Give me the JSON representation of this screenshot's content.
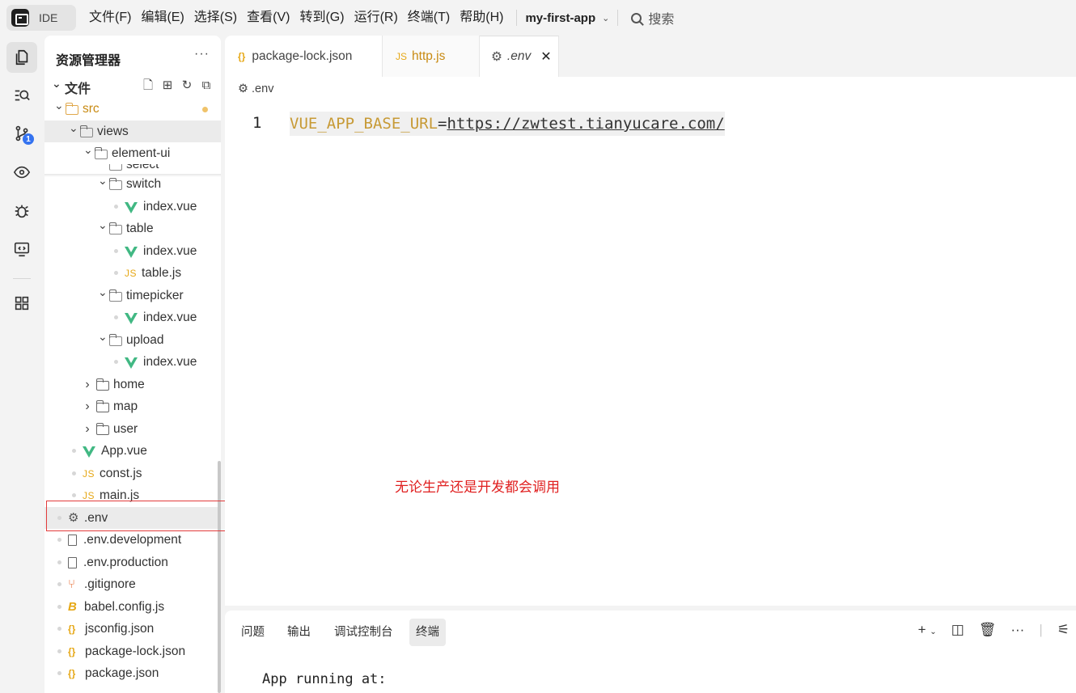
{
  "topbar": {
    "ide_label": "IDE",
    "menu": [
      "文件(F)",
      "编辑(E)",
      "选择(S)",
      "查看(V)",
      "转到(G)",
      "运行(R)",
      "终端(T)",
      "帮助(H)"
    ],
    "project": "my-first-app",
    "search": "搜索"
  },
  "activity": {
    "scm_badge": "1"
  },
  "explorer": {
    "title": "资源管理器",
    "more": "···",
    "section": "文件",
    "rows": [
      {
        "label": "src"
      },
      {
        "label": "views"
      },
      {
        "label": "element-ui"
      },
      {
        "label": "select"
      },
      {
        "label": "switch"
      },
      {
        "label": "index.vue"
      },
      {
        "label": "table"
      },
      {
        "label": "index.vue"
      },
      {
        "label": "table.js"
      },
      {
        "label": "timepicker"
      },
      {
        "label": "index.vue"
      },
      {
        "label": "upload"
      },
      {
        "label": "index.vue"
      },
      {
        "label": "home"
      },
      {
        "label": "map"
      },
      {
        "label": "user"
      },
      {
        "label": "App.vue"
      },
      {
        "label": "const.js"
      },
      {
        "label": "main.js"
      },
      {
        "label": ".env"
      },
      {
        "label": ".env.development"
      },
      {
        "label": ".env.production"
      },
      {
        "label": ".gitignore"
      },
      {
        "label": "babel.config.js"
      },
      {
        "label": "jsconfig.json"
      },
      {
        "label": "package-lock.json"
      },
      {
        "label": "package.json"
      }
    ]
  },
  "editor": {
    "tabs": [
      {
        "icon": "{}",
        "label": "package-lock.json"
      },
      {
        "icon": "JS",
        "label": "http.js"
      },
      {
        "icon": "⚙",
        "label": ".env",
        "close": "✕"
      }
    ],
    "breadcrumb": ".env",
    "line_number": "1",
    "code_key": "VUE_APP_BASE_URL",
    "code_eq": "=",
    "code_value": "https://zwtest.tianyucare.com/",
    "annotation": "无论生产还是开发都会调用"
  },
  "panel": {
    "tabs": [
      "问题",
      "输出",
      "调试控制台",
      "终端"
    ],
    "terminal_line": "App running at:"
  },
  "colors": {
    "accent": "#3573f0",
    "annotation": "#e02020",
    "highlight_box": "#e23b3b"
  }
}
